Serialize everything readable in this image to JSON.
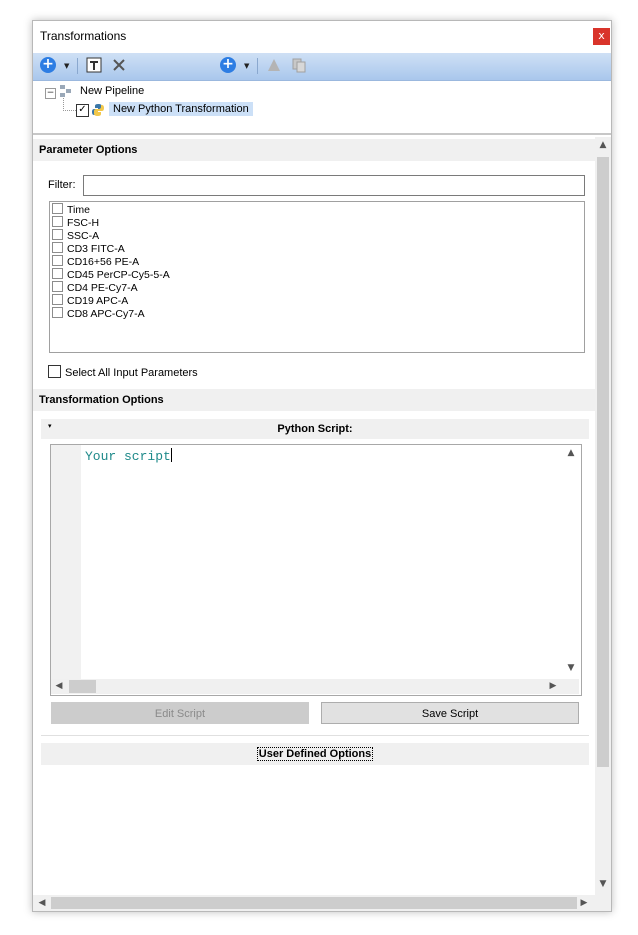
{
  "window": {
    "title": "Transformations",
    "close_glyph": "x"
  },
  "toolbar": {
    "icons": [
      "add-icon",
      "dropdown-icon",
      "text-icon",
      "delete-icon",
      "add-icon",
      "dropdown-icon",
      "move-up-icon",
      "copy-icon"
    ]
  },
  "tree": {
    "root_label": "New Pipeline",
    "child_label": "New Python Transformation",
    "child_checked": true
  },
  "parameter_options": {
    "header": "Parameter Options",
    "filter_label": "Filter:",
    "filter_value": "",
    "parameters": [
      "Time",
      "FSC-H",
      "SSC-A",
      "CD3 FITC-A",
      "CD16+56 PE-A",
      "CD45 PerCP-Cy5-5-A",
      "CD4 PE-Cy7-A",
      "CD19 APC-A",
      "CD8 APC-Cy7-A"
    ],
    "select_all_label": "Select All Input Parameters"
  },
  "transformation_options": {
    "header": "Transformation Options",
    "python_script_label": "Python Script:",
    "script_text": "Your script",
    "edit_script_label": "Edit Script",
    "save_script_label": "Save Script",
    "user_defined_label": "User Defined Options"
  }
}
